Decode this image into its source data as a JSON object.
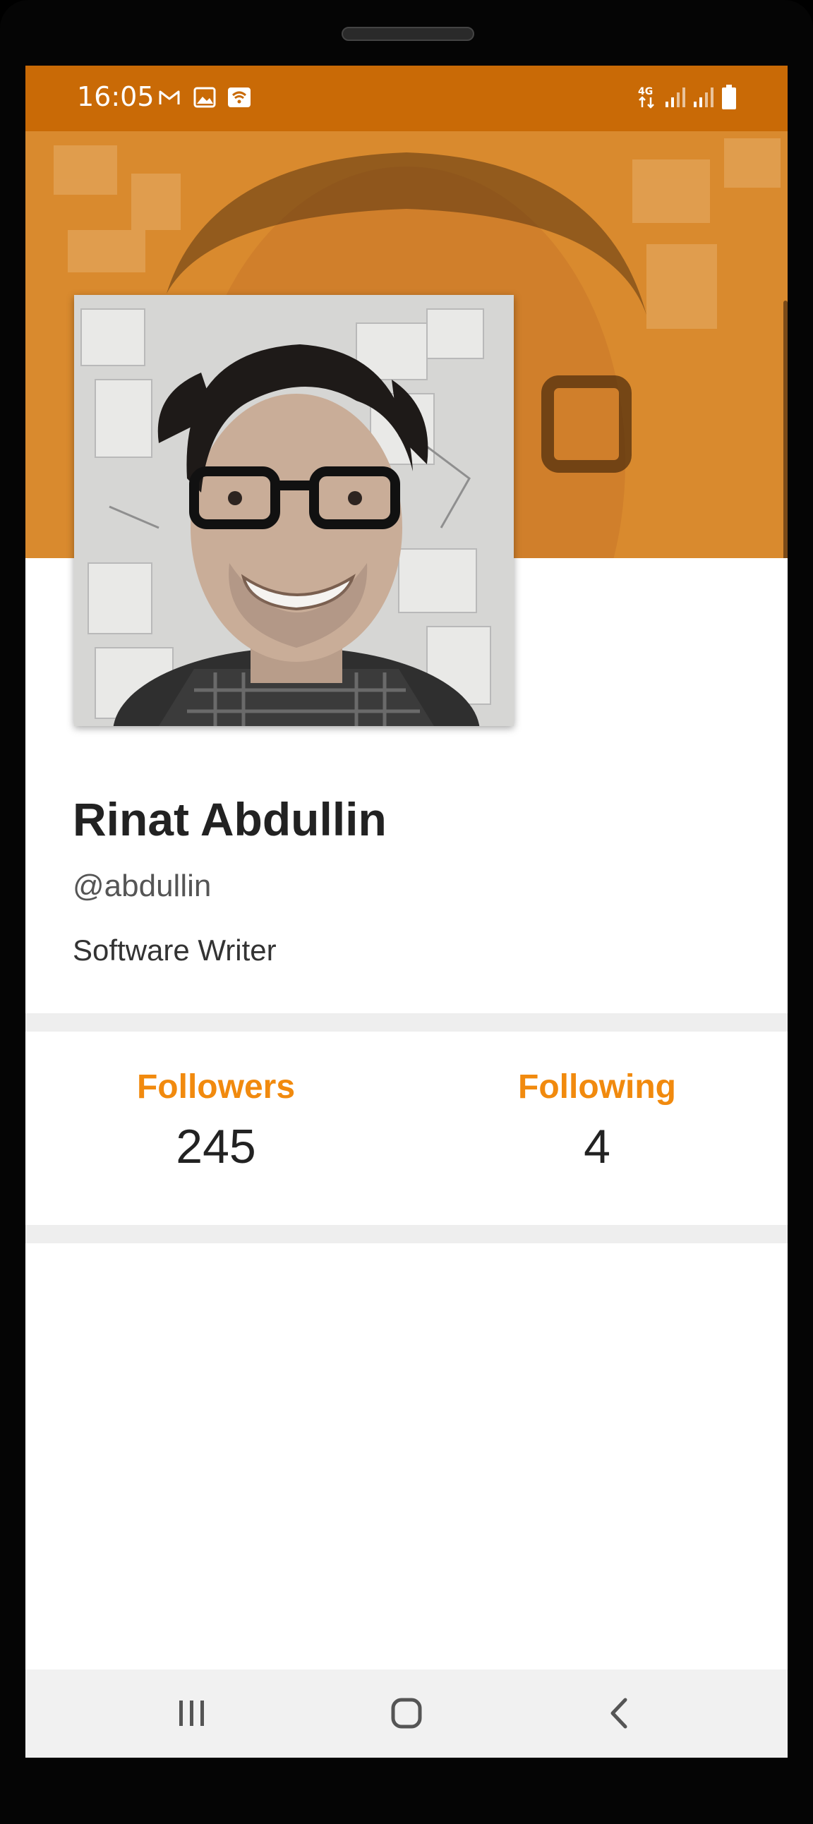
{
  "status_bar": {
    "time": "16:05",
    "left_icons": [
      "gmail-icon",
      "image-icon",
      "wifi-call-icon"
    ],
    "right_icons": [
      "4g-icon",
      "signal-icon",
      "signal-icon-2",
      "battery-icon"
    ]
  },
  "profile": {
    "name": "Rinat Abdullin",
    "handle": "@abdullin",
    "bio": "Software Writer"
  },
  "stats": [
    {
      "label": "Followers",
      "value": "245"
    },
    {
      "label": "Following",
      "value": "4"
    }
  ],
  "nav": {
    "icons": [
      "recent-apps-icon",
      "home-icon",
      "back-icon"
    ]
  },
  "colors": {
    "status_bar": "#C96A06",
    "cover": "#D98A2E",
    "accent": "#F18A0E",
    "text_primary": "#222222"
  }
}
